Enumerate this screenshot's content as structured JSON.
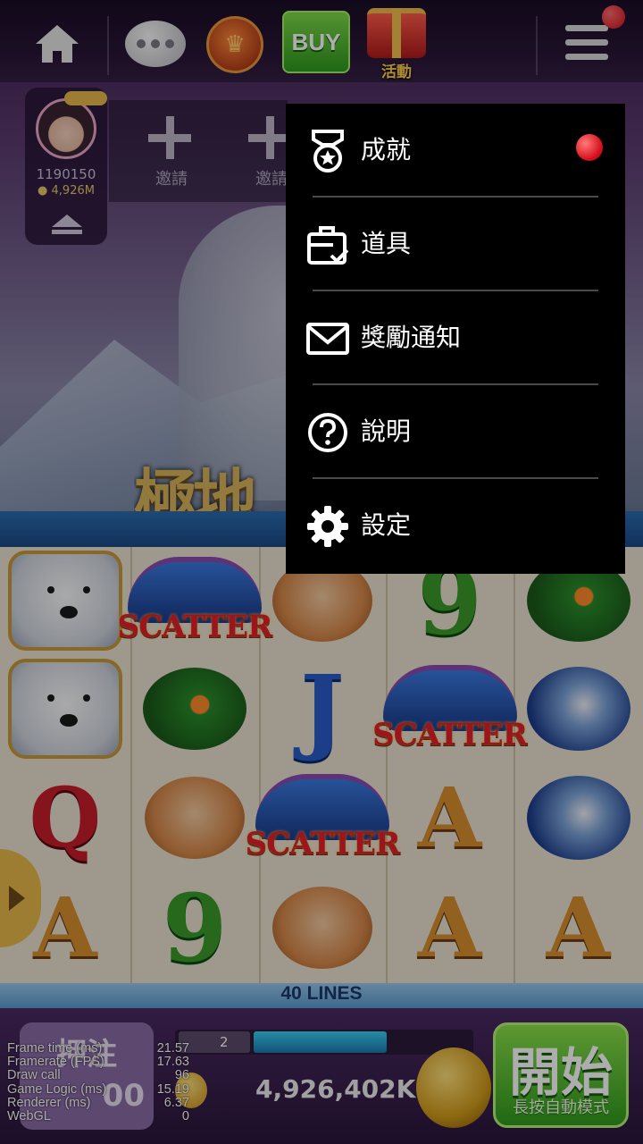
{
  "topbar": {
    "activity_label": "活動",
    "buy_label": "BUY"
  },
  "player": {
    "id": "1190150",
    "coins": "4,926M"
  },
  "invites": [
    {
      "label": "邀請"
    },
    {
      "label": "邀請"
    }
  ],
  "background": {
    "title_art": "極地"
  },
  "menu": {
    "items": [
      {
        "label": "成就",
        "icon": "medal-icon",
        "has_notification": true
      },
      {
        "label": "道具",
        "icon": "briefcase-icon",
        "has_notification": false
      },
      {
        "label": "獎勵通知",
        "icon": "mail-icon",
        "has_notification": false
      },
      {
        "label": "說明",
        "icon": "help-icon",
        "has_notification": false
      },
      {
        "label": "設定",
        "icon": "gear-icon",
        "has_notification": false
      }
    ]
  },
  "reels": {
    "columns": [
      [
        "polar-bear",
        "polar-bear",
        "Q",
        "A"
      ],
      [
        "scatter",
        "puffin",
        "fox",
        "9"
      ],
      [
        "fox",
        "J",
        "scatter",
        "fox"
      ],
      [
        "9",
        "scatter",
        "A",
        "A"
      ],
      [
        "puffin",
        "orca",
        "orca",
        "A"
      ]
    ],
    "scatter_text": "SCATTER",
    "lines_label": "40 LINES"
  },
  "bottom": {
    "bet_label": "押注",
    "bet_value": "00",
    "level": "2",
    "xp_progress": 0.62,
    "balance": "4,926,402K",
    "spin_label": "開始",
    "spin_sub": "長按自動模式"
  },
  "debug_stats": [
    {
      "label": "Frame time (ms)",
      "value": "21.57"
    },
    {
      "label": "Framerate (FPS)",
      "value": "17.63"
    },
    {
      "label": "Draw call",
      "value": "96"
    },
    {
      "label": "Game Logic (ms)",
      "value": "15.19"
    },
    {
      "label": "Renderer (ms)",
      "value": "6.37"
    },
    {
      "label": "WebGL",
      "value": "0"
    }
  ],
  "colors": {
    "menu_bg": "#000000",
    "notification": "#d8101c",
    "buy_green": "#2f9a1e",
    "activity_gold": "#ffcf4a"
  }
}
